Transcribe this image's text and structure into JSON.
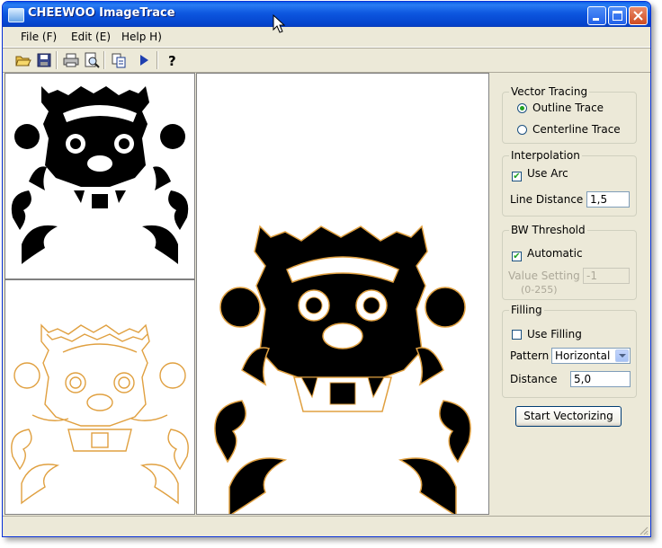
{
  "window": {
    "title": "CHEEWOO ImageTrace"
  },
  "menu": {
    "file": "File (F)",
    "edit": "Edit (E)",
    "help": "Help H)"
  },
  "icons": {
    "toolbar": [
      "open-folder-icon",
      "save-icon",
      "print-icon",
      "print-preview-icon",
      "copy-icon",
      "play-icon",
      "help-icon"
    ],
    "titlebar": [
      "minimize-icon",
      "maximize-icon",
      "close-icon"
    ]
  },
  "panel": {
    "vector_tracing": {
      "title": "Vector Tracing",
      "outline_label": "Outline Trace",
      "centerline_label": "Centerline Trace",
      "selected": "Outline Trace"
    },
    "interpolation": {
      "title": "Interpolation",
      "use_arc_label": "Use Arc",
      "use_arc_checked": true,
      "line_distance_label": "Line Distance",
      "line_distance_value": "1,5"
    },
    "bw_threshold": {
      "title": "BW Threshold",
      "automatic_label": "Automatic",
      "automatic_checked": true,
      "value_setting_label": "Value Setting",
      "value_range": "(0-255)",
      "value": "-1"
    },
    "filling": {
      "title": "Filling",
      "use_filling_label": "Use Filling",
      "use_filling_checked": false,
      "pattern_label": "Pattern",
      "pattern_value": "Horizontal",
      "distance_label": "Distance",
      "distance_value": "5,0"
    },
    "start_button": "Start Vectorizing"
  },
  "colors": {
    "titlebar": "#0a5fe6",
    "face": "#ece9d8",
    "trace_outline": "#e0a040",
    "trace_fill": "#000000"
  }
}
